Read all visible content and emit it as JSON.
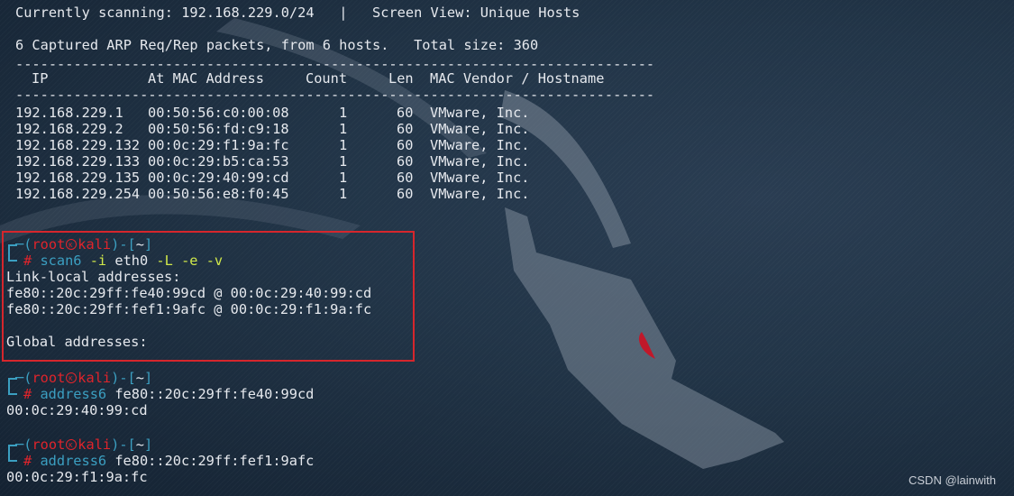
{
  "header": {
    "scanning_label": "Currently scanning: 192.168.229.0/24",
    "separator": "|",
    "screen_view": "Screen View: Unique Hosts",
    "summary": "6 Captured ARP Req/Rep packets, from 6 hosts.",
    "total_size": "Total size: 360"
  },
  "table": {
    "divider": "-----------------------------------------------------------------------------",
    "columns": {
      "ip": "IP",
      "mac": "At MAC Address",
      "count": "Count",
      "len": "Len",
      "vendor": "MAC Vendor / Hostname"
    },
    "rows": [
      {
        "ip": "192.168.229.1",
        "mac": "00:50:56:c0:00:08",
        "count": "1",
        "len": "60",
        "vendor": "VMware, Inc."
      },
      {
        "ip": "192.168.229.2",
        "mac": "00:50:56:fd:c9:18",
        "count": "1",
        "len": "60",
        "vendor": "VMware, Inc."
      },
      {
        "ip": "192.168.229.132",
        "mac": "00:0c:29:f1:9a:fc",
        "count": "1",
        "len": "60",
        "vendor": "VMware, Inc."
      },
      {
        "ip": "192.168.229.133",
        "mac": "00:0c:29:b5:ca:53",
        "count": "1",
        "len": "60",
        "vendor": "VMware, Inc."
      },
      {
        "ip": "192.168.229.135",
        "mac": "00:0c:29:40:99:cd",
        "count": "1",
        "len": "60",
        "vendor": "VMware, Inc."
      },
      {
        "ip": "192.168.229.254",
        "mac": "00:50:56:e8:f0:45",
        "count": "1",
        "len": "60",
        "vendor": "VMware, Inc."
      }
    ]
  },
  "prompt": {
    "open_paren": "(",
    "user": "root",
    "host": "kali",
    "close_mid": ")-[",
    "dir": "~",
    "close_bracket": "]",
    "hash": "#"
  },
  "commands": [
    {
      "cmd": "scan6",
      "args": [
        {
          "text": "-i",
          "style": "green"
        },
        {
          "text": "eth0",
          "style": "white"
        },
        {
          "text": "-L",
          "style": "green"
        },
        {
          "text": "-e",
          "style": "green"
        },
        {
          "text": "-v",
          "style": "green"
        }
      ],
      "output": [
        "Link-local addresses:",
        "fe80::20c:29ff:fe40:99cd @ 00:0c:29:40:99:cd",
        "fe80::20c:29ff:fef1:9afc @ 00:0c:29:f1:9a:fc",
        "",
        "Global addresses:"
      ]
    },
    {
      "cmd": "address6",
      "args": [
        {
          "text": "fe80::20c:29ff:fe40:99cd",
          "style": "white"
        }
      ],
      "output": [
        "00:0c:29:40:99:cd"
      ]
    },
    {
      "cmd": "address6",
      "args": [
        {
          "text": "fe80::20c:29ff:fef1:9afc",
          "style": "white"
        }
      ],
      "output": [
        "00:0c:29:f1:9a:fc"
      ]
    }
  ],
  "watermark": "CSDN @lainwith",
  "colors": {
    "prompt_red": "#e0242b",
    "prompt_cyan": "#3b9fc1",
    "arg_green": "#d0e84a",
    "highlight_box": "#d6262c"
  }
}
